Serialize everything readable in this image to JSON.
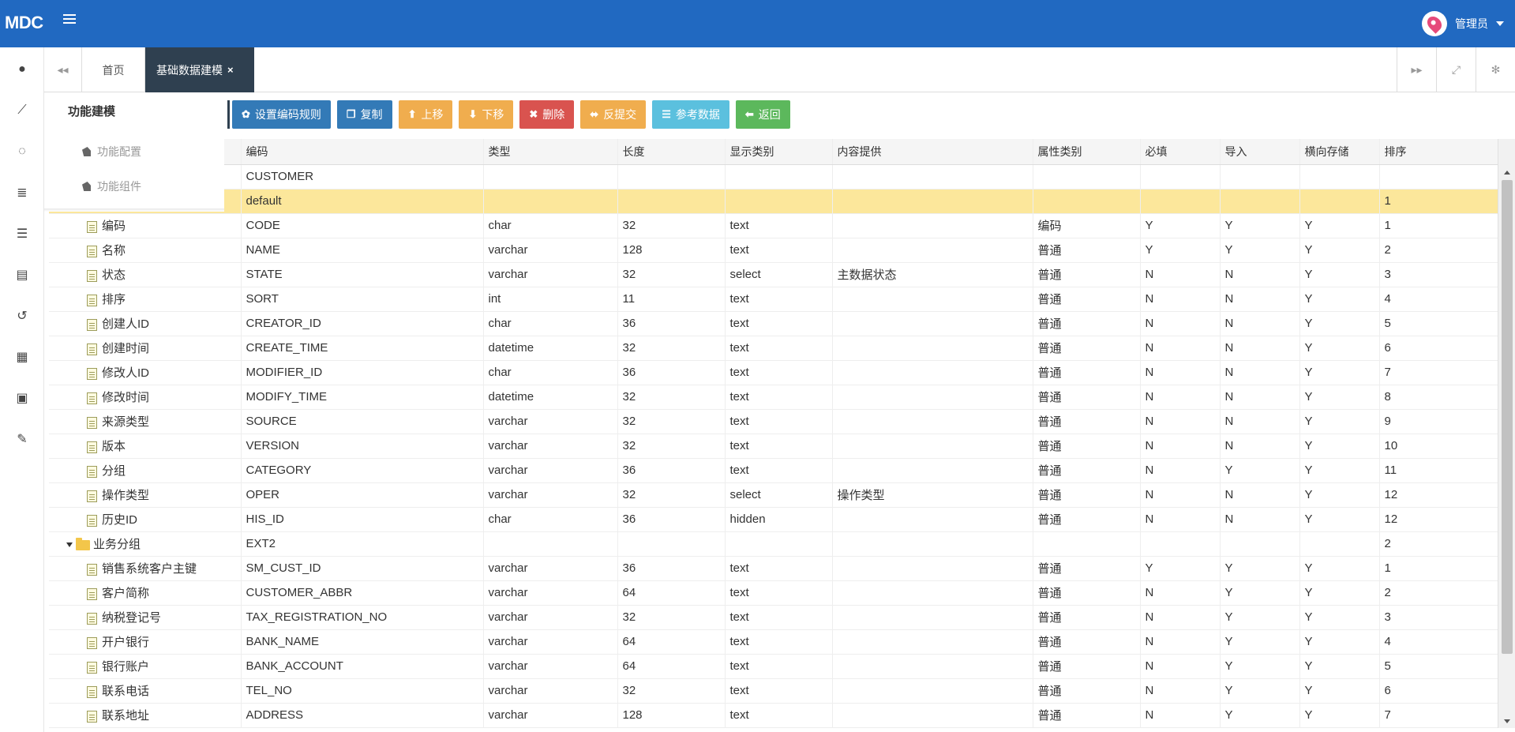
{
  "app": {
    "logo": "MDC",
    "user_name": "管理员"
  },
  "tabs": {
    "home": "首页",
    "active": "基础数据建模",
    "close": "×"
  },
  "func_panel": {
    "title": "功能建模",
    "items": [
      "功能配置",
      "功能组件"
    ]
  },
  "toolbar": {
    "buttons": [
      {
        "label": "设置编码规则",
        "icon": "gear-icon",
        "color": "#337ab7"
      },
      {
        "label": "复制",
        "icon": "copy-icon",
        "color": "#337ab7"
      },
      {
        "label": "上移",
        "icon": "arrow-up-icon",
        "color": "#f0ad4e"
      },
      {
        "label": "下移",
        "icon": "arrow-down-icon",
        "color": "#f0ad4e"
      },
      {
        "label": "删除",
        "icon": "x-icon",
        "color": "#d9534f"
      },
      {
        "label": "反提交",
        "icon": "undo-icon",
        "color": "#f0ad4e"
      },
      {
        "label": "参考数据",
        "icon": "list-icon",
        "color": "#5bc0de"
      },
      {
        "label": "返回",
        "icon": "arrow-left-icon",
        "color": "#5cb85c"
      }
    ]
  },
  "grid": {
    "columns": [
      "",
      "编码",
      "类型",
      "长度",
      "显示类别",
      "内容提供",
      "属性类别",
      "必填",
      "导入",
      "横向存储",
      "排序"
    ],
    "rows": [
      {
        "kind": "root",
        "name": "",
        "code": "CUSTOMER",
        "type": "",
        "len": "",
        "disp": "",
        "content": "",
        "attr": "",
        "req": "",
        "imp": "",
        "horiz": "",
        "sort": ""
      },
      {
        "kind": "group-highlight",
        "name": "",
        "code": "default",
        "type": "",
        "len": "",
        "disp": "",
        "content": "",
        "attr": "",
        "req": "",
        "imp": "",
        "horiz": "",
        "sort": "1"
      },
      {
        "kind": "field",
        "name": "编码",
        "code": "CODE",
        "type": "char",
        "len": "32",
        "disp": "text",
        "content": "",
        "attr": "编码",
        "req": "Y",
        "imp": "Y",
        "horiz": "Y",
        "sort": "1"
      },
      {
        "kind": "field",
        "name": "名称",
        "code": "NAME",
        "type": "varchar",
        "len": "128",
        "disp": "text",
        "content": "",
        "attr": "普通",
        "req": "Y",
        "imp": "Y",
        "horiz": "Y",
        "sort": "2"
      },
      {
        "kind": "field",
        "name": "状态",
        "code": "STATE",
        "type": "varchar",
        "len": "32",
        "disp": "select",
        "content": "主数据状态",
        "attr": "普通",
        "req": "N",
        "imp": "N",
        "horiz": "Y",
        "sort": "3"
      },
      {
        "kind": "field",
        "name": "排序",
        "code": "SORT",
        "type": "int",
        "len": "11",
        "disp": "text",
        "content": "",
        "attr": "普通",
        "req": "N",
        "imp": "N",
        "horiz": "Y",
        "sort": "4"
      },
      {
        "kind": "field",
        "name": "创建人ID",
        "code": "CREATOR_ID",
        "type": "char",
        "len": "36",
        "disp": "text",
        "content": "",
        "attr": "普通",
        "req": "N",
        "imp": "N",
        "horiz": "Y",
        "sort": "5"
      },
      {
        "kind": "field",
        "name": "创建时间",
        "code": "CREATE_TIME",
        "type": "datetime",
        "len": "32",
        "disp": "text",
        "content": "",
        "attr": "普通",
        "req": "N",
        "imp": "N",
        "horiz": "Y",
        "sort": "6"
      },
      {
        "kind": "field",
        "name": "修改人ID",
        "code": "MODIFIER_ID",
        "type": "char",
        "len": "36",
        "disp": "text",
        "content": "",
        "attr": "普通",
        "req": "N",
        "imp": "N",
        "horiz": "Y",
        "sort": "7"
      },
      {
        "kind": "field",
        "name": "修改时间",
        "code": "MODIFY_TIME",
        "type": "datetime",
        "len": "32",
        "disp": "text",
        "content": "",
        "attr": "普通",
        "req": "N",
        "imp": "N",
        "horiz": "Y",
        "sort": "8"
      },
      {
        "kind": "field",
        "name": "来源类型",
        "code": "SOURCE",
        "type": "varchar",
        "len": "32",
        "disp": "text",
        "content": "",
        "attr": "普通",
        "req": "N",
        "imp": "N",
        "horiz": "Y",
        "sort": "9"
      },
      {
        "kind": "field",
        "name": "版本",
        "code": "VERSION",
        "type": "varchar",
        "len": "32",
        "disp": "text",
        "content": "",
        "attr": "普通",
        "req": "N",
        "imp": "N",
        "horiz": "Y",
        "sort": "10"
      },
      {
        "kind": "field",
        "name": "分组",
        "code": "CATEGORY",
        "type": "varchar",
        "len": "36",
        "disp": "text",
        "content": "",
        "attr": "普通",
        "req": "N",
        "imp": "Y",
        "horiz": "Y",
        "sort": "11"
      },
      {
        "kind": "field",
        "name": "操作类型",
        "code": "OPER",
        "type": "varchar",
        "len": "32",
        "disp": "select",
        "content": "操作类型",
        "attr": "普通",
        "req": "N",
        "imp": "N",
        "horiz": "Y",
        "sort": "12"
      },
      {
        "kind": "field",
        "name": "历史ID",
        "code": "HIS_ID",
        "type": "char",
        "len": "36",
        "disp": "hidden",
        "content": "",
        "attr": "普通",
        "req": "N",
        "imp": "N",
        "horiz": "Y",
        "sort": "12"
      },
      {
        "kind": "group",
        "name": "业务分组",
        "code": "EXT2",
        "type": "",
        "len": "",
        "disp": "",
        "content": "",
        "attr": "",
        "req": "",
        "imp": "",
        "horiz": "",
        "sort": "2"
      },
      {
        "kind": "field",
        "name": "销售系统客户主键",
        "code": "SM_CUST_ID",
        "type": "varchar",
        "len": "36",
        "disp": "text",
        "content": "",
        "attr": "普通",
        "req": "Y",
        "imp": "Y",
        "horiz": "Y",
        "sort": "1"
      },
      {
        "kind": "field",
        "name": "客户简称",
        "code": "CUSTOMER_ABBR",
        "type": "varchar",
        "len": "64",
        "disp": "text",
        "content": "",
        "attr": "普通",
        "req": "N",
        "imp": "Y",
        "horiz": "Y",
        "sort": "2"
      },
      {
        "kind": "field",
        "name": "纳税登记号",
        "code": "TAX_REGISTRATION_NO",
        "type": "varchar",
        "len": "32",
        "disp": "text",
        "content": "",
        "attr": "普通",
        "req": "N",
        "imp": "Y",
        "horiz": "Y",
        "sort": "3"
      },
      {
        "kind": "field",
        "name": "开户银行",
        "code": "BANK_NAME",
        "type": "varchar",
        "len": "64",
        "disp": "text",
        "content": "",
        "attr": "普通",
        "req": "N",
        "imp": "Y",
        "horiz": "Y",
        "sort": "4"
      },
      {
        "kind": "field",
        "name": "银行账户",
        "code": "BANK_ACCOUNT",
        "type": "varchar",
        "len": "64",
        "disp": "text",
        "content": "",
        "attr": "普通",
        "req": "N",
        "imp": "Y",
        "horiz": "Y",
        "sort": "5"
      },
      {
        "kind": "field",
        "name": "联系电话",
        "code": "TEL_NO",
        "type": "varchar",
        "len": "32",
        "disp": "text",
        "content": "",
        "attr": "普通",
        "req": "N",
        "imp": "Y",
        "horiz": "Y",
        "sort": "6"
      },
      {
        "kind": "field",
        "name": "联系地址",
        "code": "ADDRESS",
        "type": "varchar",
        "len": "128",
        "disp": "text",
        "content": "",
        "attr": "普通",
        "req": "N",
        "imp": "Y",
        "horiz": "Y",
        "sort": "7"
      }
    ]
  }
}
